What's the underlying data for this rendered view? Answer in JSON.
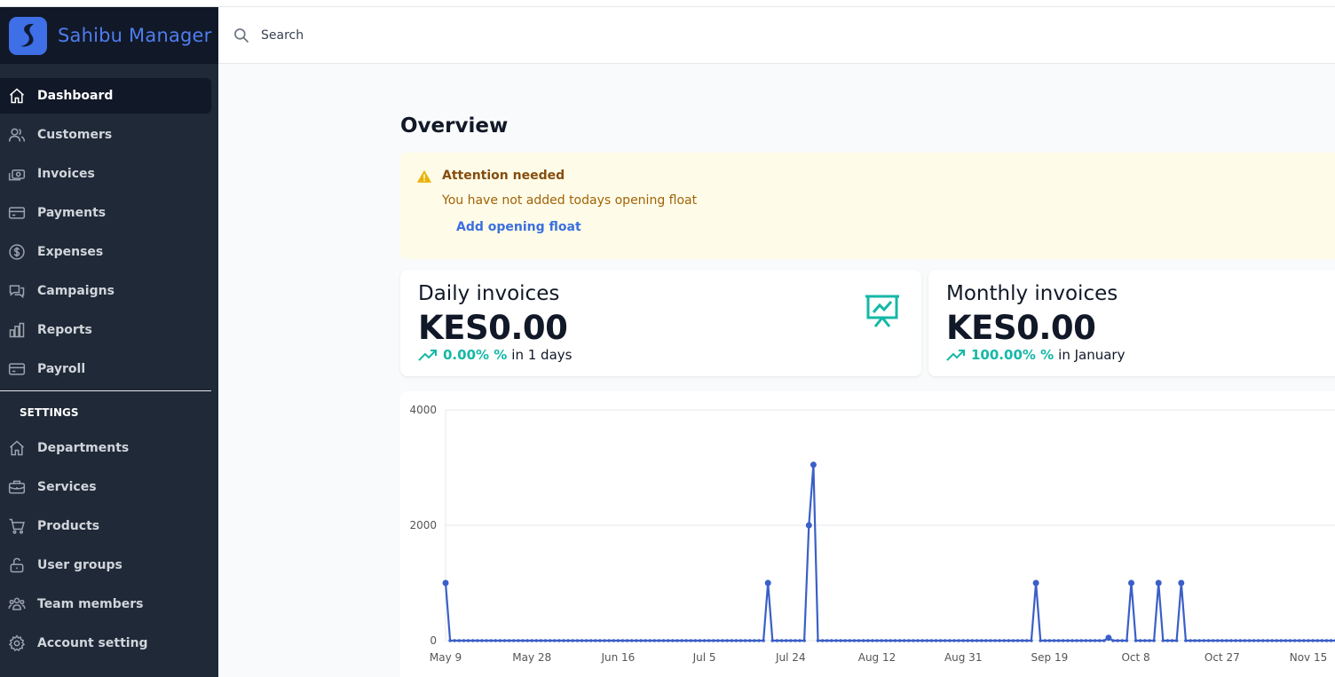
{
  "app": {
    "name": "Sahibu Manager"
  },
  "sidebar": {
    "items": [
      {
        "label": "Dashboard",
        "icon": "home-icon",
        "active": true
      },
      {
        "label": "Customers",
        "icon": "users-icon"
      },
      {
        "label": "Invoices",
        "icon": "cash-icon"
      },
      {
        "label": "Payments",
        "icon": "credit-card-icon"
      },
      {
        "label": "Expenses",
        "icon": "dollar-circle-icon"
      },
      {
        "label": "Campaigns",
        "icon": "chat-icon"
      },
      {
        "label": "Reports",
        "icon": "bar-chart-icon"
      },
      {
        "label": "Payroll",
        "icon": "card-icon"
      }
    ],
    "settings_label": "SETTINGS",
    "settings_items": [
      {
        "label": "Departments",
        "icon": "home-icon"
      },
      {
        "label": "Services",
        "icon": "briefcase-icon"
      },
      {
        "label": "Products",
        "icon": "cart-icon"
      },
      {
        "label": "User groups",
        "icon": "lock-open-icon"
      },
      {
        "label": "Team members",
        "icon": "user-group-icon"
      },
      {
        "label": "Account setting",
        "icon": "gear-icon"
      }
    ]
  },
  "search": {
    "placeholder": "Search",
    "icon": "search-icon"
  },
  "main": {
    "title": "Overview",
    "alert": {
      "title": "Attention needed",
      "message": "You have not added todays opening float",
      "action": "Add opening float",
      "icon": "warning-icon"
    },
    "cards": [
      {
        "title": "Daily invoices",
        "value": "KES0.00",
        "change": "0.00% %",
        "period": "in 1 days",
        "icon": "presentation-chart-icon"
      },
      {
        "title": "Monthly invoices",
        "value": "KES0.00",
        "change": "100.00% %",
        "period": "in January"
      }
    ]
  },
  "colors": {
    "sidebar": "#1f2937",
    "accent": "#14b8a6",
    "brand": "#4f7df0",
    "line": "#3b5fc8"
  },
  "chart_data": {
    "type": "line",
    "x_tick_labels": [
      "May 9",
      "May 28",
      "Jun 16",
      "Jul 5",
      "Jul 24",
      "Aug 12",
      "Aug 31",
      "Sep 19",
      "Oct 8",
      "Oct 27",
      "Nov 15"
    ],
    "y_ticks": [
      0,
      2000,
      4000
    ],
    "ylim": [
      0,
      4000
    ],
    "grid": true,
    "series": [
      {
        "points": [
          {
            "x": "May 9",
            "y": 1000
          },
          {
            "x": "Jul 19",
            "y": 1000
          },
          {
            "x": "Jul 28",
            "y": 2000
          },
          {
            "x": "Jul 29",
            "y": 3050
          },
          {
            "x": "Sep 16",
            "y": 1000
          },
          {
            "x": "Oct 2",
            "y": 50
          },
          {
            "x": "Oct 7",
            "y": 1000
          },
          {
            "x": "Oct 13",
            "y": 1000
          },
          {
            "x": "Oct 18",
            "y": 1000
          }
        ],
        "baseline": 0
      }
    ]
  }
}
